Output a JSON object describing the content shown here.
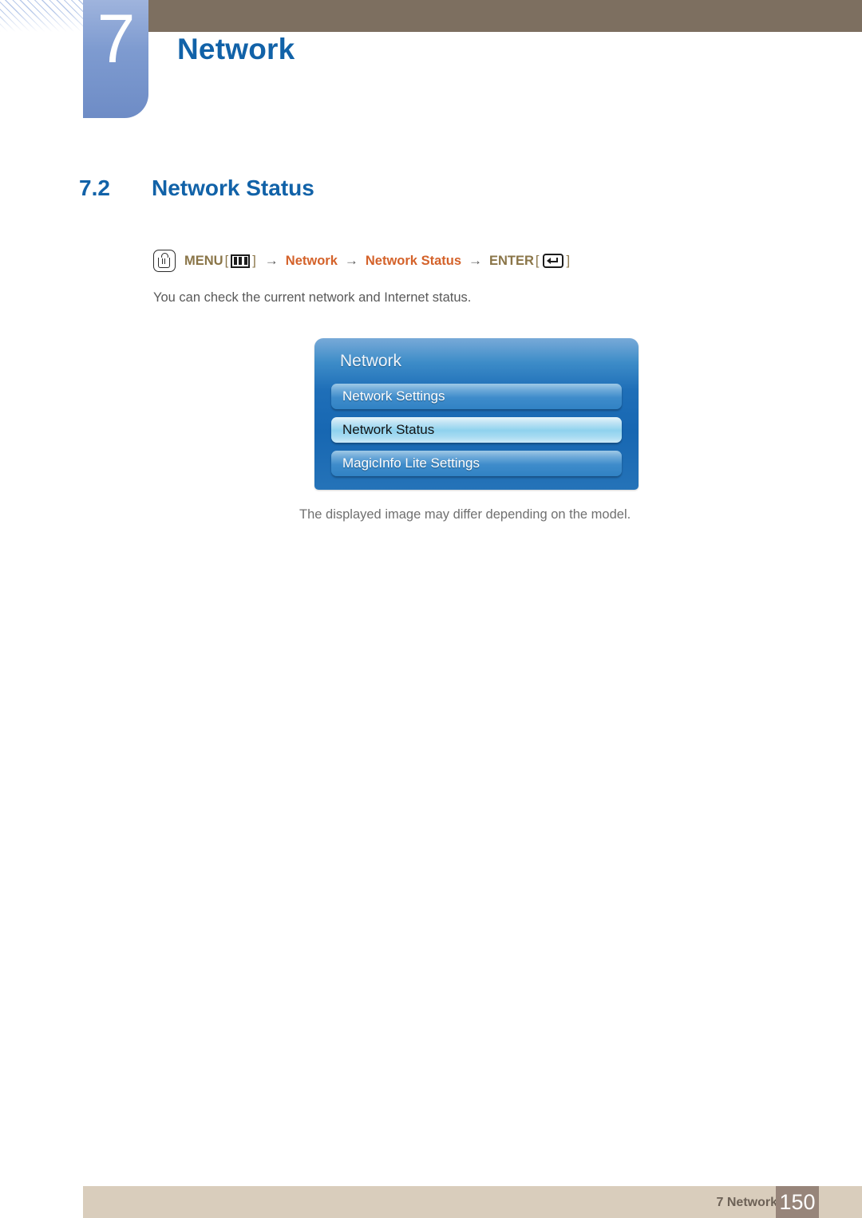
{
  "banner": {
    "chapter_number": "7",
    "chapter_title": "Network",
    "brown_bar_color": "#7d6f60",
    "badge_color": "#7e9bd0",
    "heading_color": "#1162a8"
  },
  "section": {
    "number": "7.2",
    "title": "Network Status"
  },
  "menu_path": {
    "touch_icon": "touch-hand-icon",
    "menu_label": "MENU",
    "menu_icon": "menu-bars-icon",
    "bracket_open": "[",
    "bracket_close": "]",
    "arrow": "→",
    "step1": "Network",
    "step2": "Network Status",
    "enter_label": "ENTER",
    "enter_icon": "enter-return-icon",
    "label_color": "#8a7548",
    "highlight_color": "#d4622a"
  },
  "body": {
    "description": "You can check the current network and Internet status.",
    "caption": "The displayed image may differ depending on the model."
  },
  "osd": {
    "title": "Network",
    "items": [
      {
        "label": "Network Settings",
        "selected": false
      },
      {
        "label": "Network Status",
        "selected": true
      },
      {
        "label": "MagicInfo Lite Settings",
        "selected": false
      }
    ],
    "panel_color": "#1f6fb8",
    "selected_color": "#8fd2ee"
  },
  "footer": {
    "label": "7 Network",
    "page_number": "150",
    "bar_color": "#d9cdbc",
    "page_box_color": "#97857a"
  }
}
